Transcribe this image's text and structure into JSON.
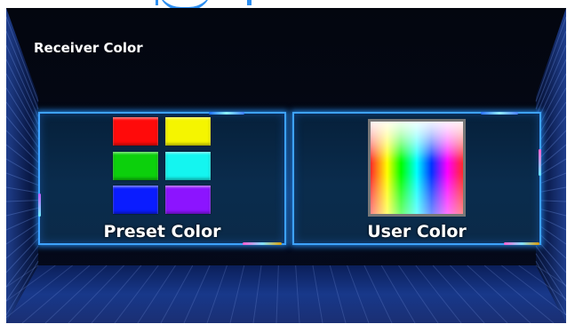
{
  "screen": {
    "title": "Receiver Color",
    "background": "#02050d",
    "accent": "#3ea2ff"
  },
  "cards": {
    "preset": {
      "label": "Preset Color",
      "icon": "preset-color-grid-icon",
      "swatches": [
        {
          "name": "red",
          "color": "#ff0a0a"
        },
        {
          "name": "yellow",
          "color": "#f5f500"
        },
        {
          "name": "green",
          "color": "#0cd00c"
        },
        {
          "name": "cyan",
          "color": "#14f5f0"
        },
        {
          "name": "blue",
          "color": "#0a1cff"
        },
        {
          "name": "purple",
          "color": "#8c14ff"
        }
      ]
    },
    "user": {
      "label": "User Color",
      "icon": "color-palette-icon"
    }
  }
}
